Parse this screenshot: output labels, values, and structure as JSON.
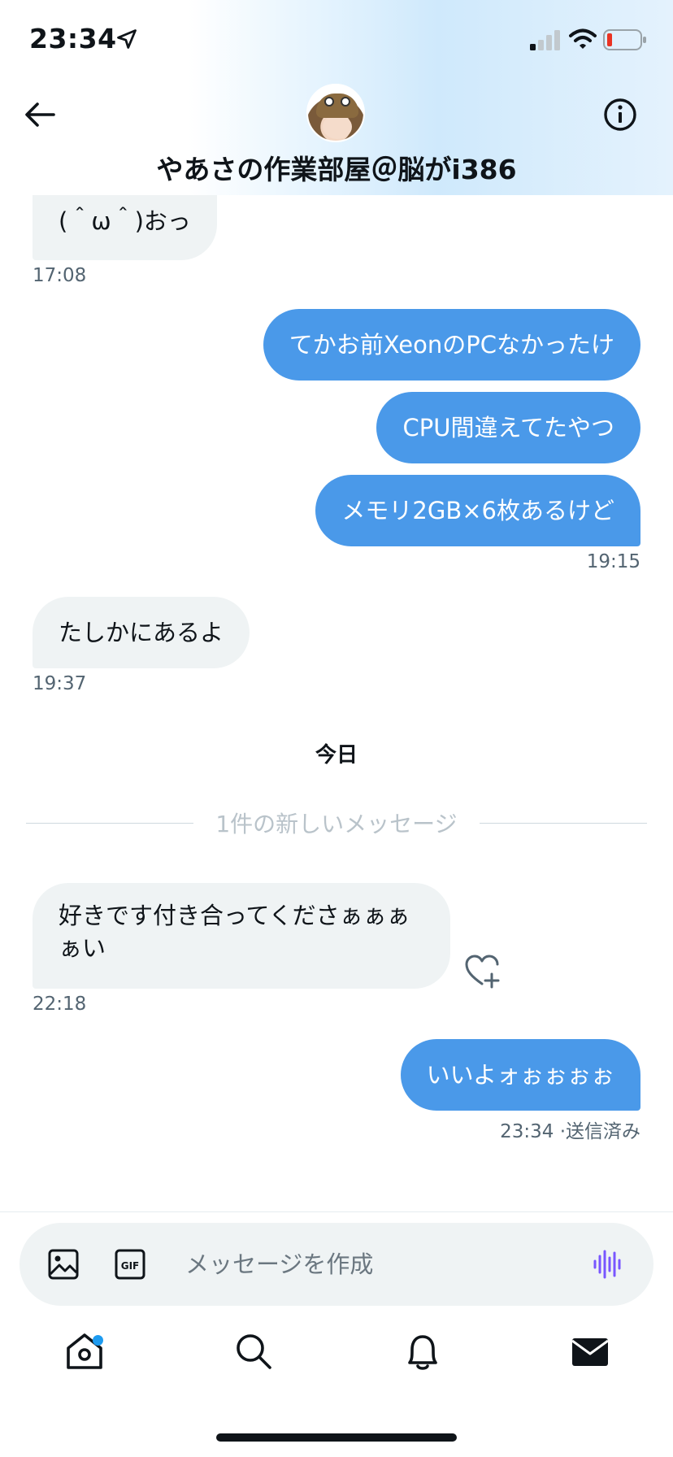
{
  "status_bar": {
    "time": "23:34"
  },
  "header": {
    "display_name": "やあさの作業部屋＠脳がi386"
  },
  "messages": [
    {
      "direction": "in",
      "text": "(＾ω＾)おっ",
      "time": "17:08"
    },
    {
      "direction": "out",
      "text": "てかお前XeonのPCなかったけ"
    },
    {
      "direction": "out",
      "text": "CPU間違えてたやつ"
    },
    {
      "direction": "out",
      "text": "メモリ2GB×6枚あるけど",
      "time": "19:15"
    },
    {
      "direction": "in",
      "text": "たしかにあるよ",
      "time": "19:37"
    },
    {
      "direction": "in",
      "text_line1": "好きです付き合ってくださぁぁぁ",
      "text_line2": "ぁい",
      "time": "22:18"
    },
    {
      "direction": "out",
      "text": "いいよォぉぉぉぉ",
      "time": "23:34",
      "status": "·送信済み"
    }
  ],
  "day_separator": "今日",
  "new_messages_label": "1件の新しいメッセージ",
  "composer": {
    "placeholder": "メッセージを作成"
  },
  "colors": {
    "outgoing_bubble": "#4a99e9",
    "incoming_bubble": "#eff3f4",
    "accent": "#1d9bf0",
    "voice_icon": "#7856ff"
  },
  "icons": {
    "back": "arrow-left-icon",
    "info": "info-circle-icon",
    "heart": "heart-plus-icon",
    "image": "image-icon",
    "gif": "gif-icon",
    "voice": "voice-wave-icon",
    "tabs": [
      "home-icon",
      "search-icon",
      "bell-icon",
      "envelope-icon"
    ]
  }
}
